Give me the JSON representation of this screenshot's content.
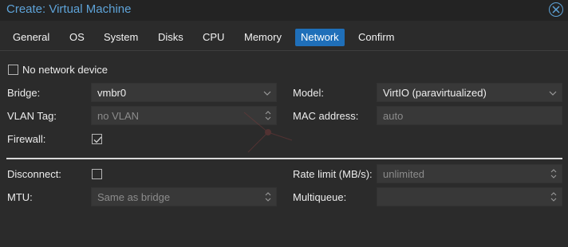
{
  "window": {
    "title": "Create: Virtual Machine",
    "close_icon": "close-icon"
  },
  "tabs": [
    {
      "label": "General",
      "active": false
    },
    {
      "label": "OS",
      "active": false
    },
    {
      "label": "System",
      "active": false
    },
    {
      "label": "Disks",
      "active": false
    },
    {
      "label": "CPU",
      "active": false
    },
    {
      "label": "Memory",
      "active": false
    },
    {
      "label": "Network",
      "active": true
    },
    {
      "label": "Confirm",
      "active": false
    }
  ],
  "form": {
    "no_network_device": {
      "label": "No network device",
      "checked": false
    },
    "bridge": {
      "label": "Bridge:",
      "value": "vmbr0"
    },
    "model": {
      "label": "Model:",
      "value": "VirtIO (paravirtualized)"
    },
    "vlan_tag": {
      "label": "VLAN Tag:",
      "value": "no VLAN"
    },
    "mac_address": {
      "label": "MAC address:",
      "value": "auto"
    },
    "firewall": {
      "label": "Firewall:",
      "checked": true
    },
    "disconnect": {
      "label": "Disconnect:",
      "checked": false
    },
    "rate_limit": {
      "label": "Rate limit (MB/s):",
      "value": "unlimited"
    },
    "mtu": {
      "label": "MTU:",
      "value": "Same as bridge"
    },
    "multiqueue": {
      "label": "Multiqueue:",
      "value": ""
    }
  },
  "colors": {
    "accent": "#1f6fb9",
    "title": "#5ea3d8",
    "background": "#2b2b2b",
    "field": "#383838"
  }
}
